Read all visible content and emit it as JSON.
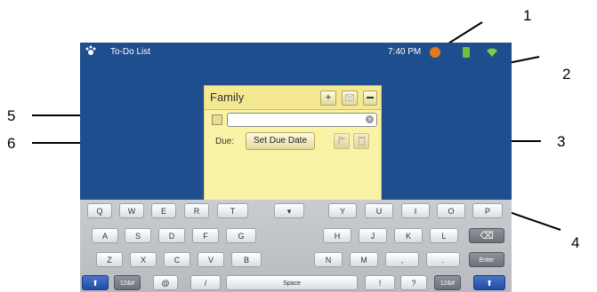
{
  "statusbar": {
    "app_title": "To-Do List",
    "time": "7:40",
    "time_suffix": "PM"
  },
  "note": {
    "title": "Family",
    "add_glyph": "+",
    "due_label": "Due:",
    "due_button": "Set Due Date",
    "clear_glyph": "×"
  },
  "keyboard": {
    "row1": [
      "Q",
      "W",
      "E",
      "R",
      "T",
      "Y",
      "U",
      "I",
      "O",
      "P"
    ],
    "row2": [
      "A",
      "S",
      "D",
      "F",
      "G",
      "H",
      "J",
      "K",
      "L"
    ],
    "row3": [
      "Z",
      "X",
      "C",
      "V",
      "B",
      "N",
      "M",
      ",",
      "."
    ],
    "mode_left": "12&#",
    "mode_right": "12&#",
    "at": "@",
    "slash": "/",
    "space": "Space",
    "bang": "!",
    "question": "?",
    "enter": "Enter",
    "shift_glyph": "⬆",
    "backspace_glyph": "⌫",
    "hide_glyph": "▾"
  },
  "annotations": [
    "1",
    "2",
    "3",
    "4",
    "5",
    "6"
  ],
  "colors": {
    "screen_bg": "#1f4e8e",
    "note_bg": "#faf3a6"
  }
}
